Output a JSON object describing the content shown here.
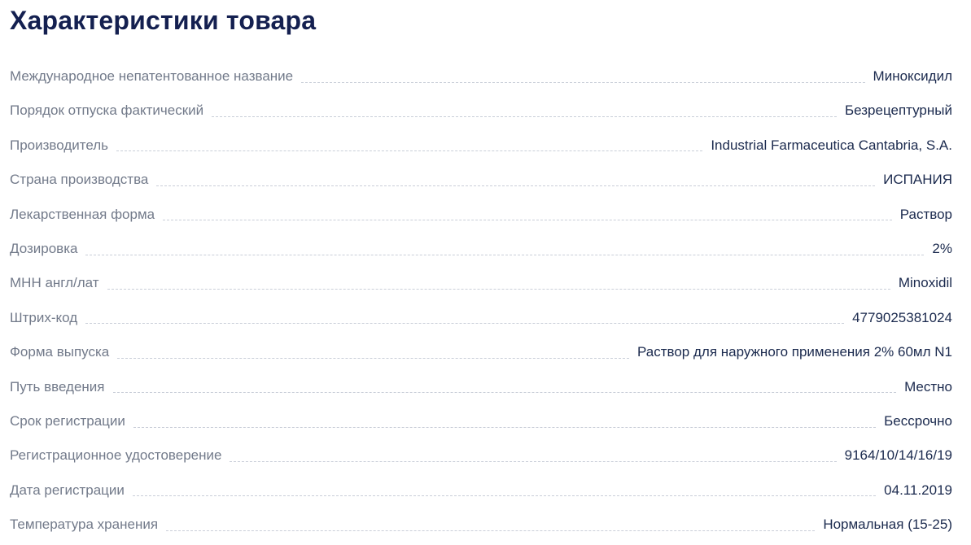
{
  "title": "Характеристики товара",
  "specs": [
    {
      "label": "Международное непатентованное название",
      "value": "Миноксидил"
    },
    {
      "label": "Порядок отпуска фактический",
      "value": "Безрецептурный"
    },
    {
      "label": "Производитель",
      "value": "Industrial Farmaceutica Cantabria, S.A."
    },
    {
      "label": "Страна производства",
      "value": "ИСПАНИЯ"
    },
    {
      "label": "Лекарственная форма",
      "value": "Раствор"
    },
    {
      "label": "Дозировка",
      "value": "2%"
    },
    {
      "label": "МНН англ/лат",
      "value": "Minoxidil"
    },
    {
      "label": "Штрих-код",
      "value": "4779025381024"
    },
    {
      "label": "Форма выпуска",
      "value": "Раствор для наружного применения 2% 60мл N1"
    },
    {
      "label": "Путь введения",
      "value": "Местно"
    },
    {
      "label": "Срок регистрации",
      "value": "Бессрочно"
    },
    {
      "label": "Регистрационное удостоверение",
      "value": "9164/10/14/16/19"
    },
    {
      "label": "Дата регистрации",
      "value": "04.11.2019"
    },
    {
      "label": "Температура хранения",
      "value": "Нормальная (15-25)"
    }
  ]
}
